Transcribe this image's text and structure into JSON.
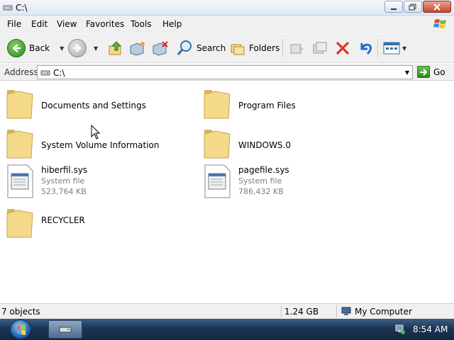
{
  "window": {
    "title": "C:\\",
    "min_icon": "minimize-icon",
    "max_icon": "maximize-icon",
    "close_icon": "close-icon"
  },
  "menu": [
    "File",
    "Edit",
    "View",
    "Favorites",
    "Tools",
    "Help"
  ],
  "toolbar": {
    "back_label": "Back",
    "search_label": "Search",
    "folders_label": "Folders"
  },
  "address": {
    "label": "Address",
    "value": "C:\\",
    "go_label": "Go"
  },
  "items": [
    {
      "name": "Documents and Settings",
      "type": "folder"
    },
    {
      "name": "Program Files",
      "type": "folder"
    },
    {
      "name": "System Volume Information",
      "type": "folder"
    },
    {
      "name": "WINDOWS.0",
      "type": "folder"
    },
    {
      "name": "hiberfil.sys",
      "type": "file",
      "kind": "System file",
      "size": "523,764 KB"
    },
    {
      "name": "pagefile.sys",
      "type": "file",
      "kind": "System file",
      "size": "786,432 KB"
    },
    {
      "name": "RECYCLER",
      "type": "folder"
    }
  ],
  "status": {
    "objects": "7 objects",
    "size": "1.24 GB",
    "location": "My Computer"
  },
  "taskbar": {
    "clock": "8:54 AM"
  },
  "colors": {
    "folder": "#f4d98a",
    "folder_dark": "#d9b65a",
    "taskbar": "#1c3554",
    "accent_green": "#2e8a1f"
  }
}
